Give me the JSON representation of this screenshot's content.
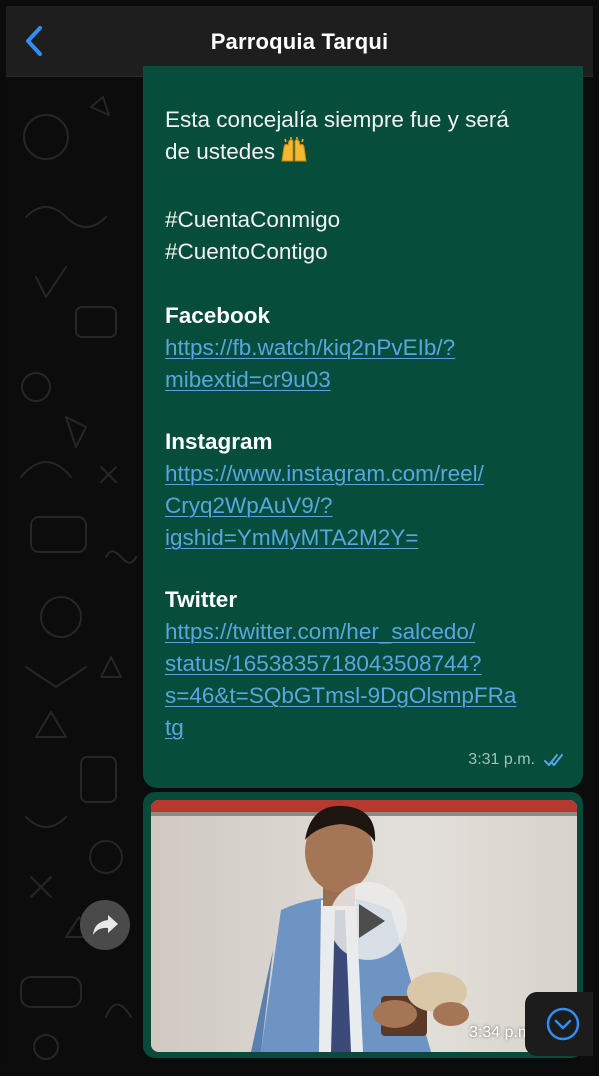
{
  "header": {
    "title": "Parroquia Tarqui",
    "back_icon": "chevron-left-icon"
  },
  "colors": {
    "accent": "#2f8ef7",
    "bubble_outgoing": "#064d3b",
    "link": "#58a6df",
    "header_bg": "#1e1e1e"
  },
  "message": {
    "line1": "Esta concejalía siempre fue y será",
    "line2": "de ustedes",
    "emoji": "raising-hands-emoji",
    "hashtag1": "#CuentaConmigo",
    "hashtag2": "#CuentoContigo",
    "facebook": {
      "heading": "Facebook",
      "link_line1": "https://fb.watch/kiq2nPvEIb/?",
      "link_line2": "mibextid=cr9u03"
    },
    "instagram": {
      "heading": "Instagram",
      "link_line1": "https://www.instagram.com/reel/",
      "link_line2": "Cryq2WpAuV9/?",
      "link_line3": "igshid=YmMyMTA2M2Y="
    },
    "twitter": {
      "heading": "Twitter",
      "link_line1": "https://twitter.com/her_salcedo/",
      "link_line2": "status/1653835718043508744?",
      "link_line3": "s=46&t=SQbGTmsl-9DgOlsmpFRa",
      "link_line4": "tg"
    },
    "time": "3:31 p.m.",
    "status_icon": "double-check-read-icon"
  },
  "video_message": {
    "time": "3:34 p.m.",
    "play_icon": "play-icon"
  },
  "actions": {
    "forward_icon": "forward-share-icon",
    "scroll_down_icon": "chevron-down-circle-icon"
  }
}
